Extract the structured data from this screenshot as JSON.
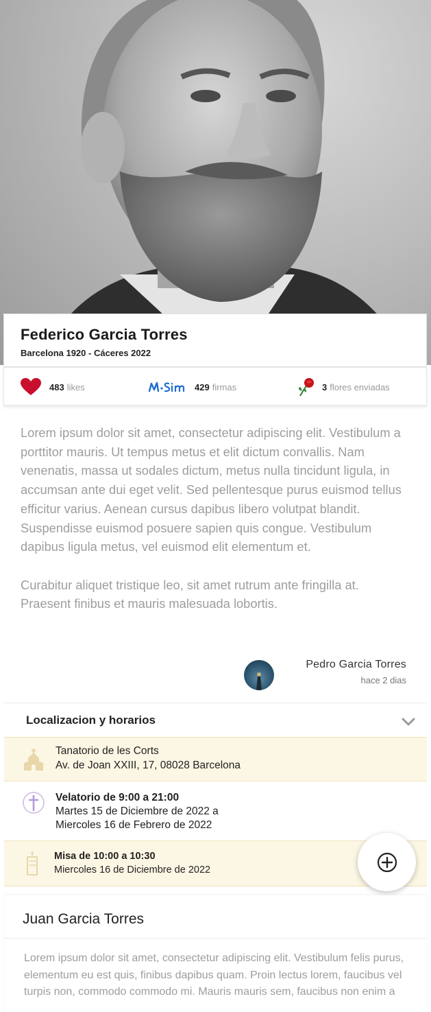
{
  "profile": {
    "name": "Federico Garcia Torres",
    "dates": "Barcelona 1920 -  Cáceres 2022"
  },
  "stats": {
    "likes_count": "483",
    "likes_label": "likes",
    "signatures_count": "429",
    "signatures_label": "firmas",
    "flowers_count": "3",
    "flowers_label": "flores enviadas",
    "heart_color": "#c8102e",
    "signature_color": "#1e6fd0"
  },
  "tribute": {
    "paragraph1": "Lorem ipsum dolor sit amet, consectetur adipiscing elit. Vestibulum a porttitor mauris. Ut tempus metus et elit dictum convallis. Nam venenatis, massa ut sodales dictum, metus nulla tincidunt ligula, in accumsan ante dui eget velit. Sed pellentesque purus euismod tellus efficitur varius. Aenean cursus dapibus libero volutpat blandit. Suspendisse euismod posuere sapien quis congue. Vestibulum dapibus ligula metus, vel euismod elit elementum et.",
    "paragraph2": "Curabitur aliquet tristique leo, sit amet rutrum ante fringilla at. Praesent finibus et mauris malesuada lobortis.",
    "author": "Pedro Garcia Torres",
    "time_ago": "hace 2 dias"
  },
  "location": {
    "title": "Localizacion y horarios",
    "place_name": "Tanatorio de les Corts",
    "place_address": "Av. de Joan XXIII, 17,  08028 Barcelona",
    "wake_title": "Velatorio de 9:00 a 21:00",
    "wake_line1": "Martes 15 de Diciembre de 2022 a",
    "wake_line2": "Miercoles 16 de Febrero de 2022",
    "mass_title": "Misa de 10:00 a 10:30",
    "mass_date": "Miercoles 16 de Diciembre de 2022",
    "accent_color": "#e8d7a8"
  },
  "second_card": {
    "name": "Juan Garcia Torres",
    "text": "Lorem ipsum dolor sit amet, consectetur adipiscing elit. Vestibulum felis purus, elementum eu est quis, finibus dapibus quam. Proin lectus lorem, faucibus vel turpis non, commodo commodo mi. Mauris mauris sem, faucibus non enim a"
  },
  "icons": {
    "heart": "heart-icon",
    "signature": "signature-icon",
    "rose": "rose-icon",
    "church": "church-icon",
    "cross": "cross-icon",
    "candle": "candle-icon",
    "add": "add-circle-icon",
    "chevron": "chevron-down-icon"
  }
}
